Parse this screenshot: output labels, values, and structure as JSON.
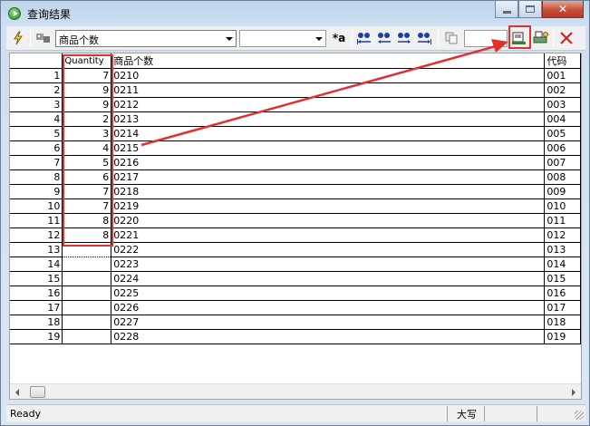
{
  "window": {
    "title": "查询结果"
  },
  "toolbar": {
    "field_combo_value": "商品个数",
    "filter_combo_value": "",
    "search_input_value": "",
    "regex_label": "*a"
  },
  "grid": {
    "columns": [
      "",
      "Quantity",
      "商品个数",
      "代码"
    ],
    "rows": [
      {
        "n": "1",
        "qty": "7",
        "code": "0210",
        "extra": "001"
      },
      {
        "n": "2",
        "qty": "9",
        "code": "0211",
        "extra": "002"
      },
      {
        "n": "3",
        "qty": "9",
        "code": "0212",
        "extra": "003"
      },
      {
        "n": "4",
        "qty": "2",
        "code": "0213",
        "extra": "004"
      },
      {
        "n": "5",
        "qty": "3",
        "code": "0214",
        "extra": "005"
      },
      {
        "n": "6",
        "qty": "4",
        "code": "0215",
        "extra": "006"
      },
      {
        "n": "7",
        "qty": "5",
        "code": "0216",
        "extra": "007"
      },
      {
        "n": "8",
        "qty": "6",
        "code": "0217",
        "extra": "008"
      },
      {
        "n": "9",
        "qty": "7",
        "code": "0218",
        "extra": "009"
      },
      {
        "n": "10",
        "qty": "7",
        "code": "0219",
        "extra": "010"
      },
      {
        "n": "11",
        "qty": "8",
        "code": "0220",
        "extra": "011"
      },
      {
        "n": "12",
        "qty": "8",
        "code": "0221",
        "extra": "012"
      },
      {
        "n": "13",
        "qty": "",
        "code": "0222",
        "extra": "013"
      },
      {
        "n": "14",
        "qty": "",
        "code": "0223",
        "extra": "014"
      },
      {
        "n": "15",
        "qty": "",
        "code": "0224",
        "extra": "015"
      },
      {
        "n": "16",
        "qty": "",
        "code": "0225",
        "extra": "016"
      },
      {
        "n": "17",
        "qty": "",
        "code": "0226",
        "extra": "017"
      },
      {
        "n": "18",
        "qty": "",
        "code": "0227",
        "extra": "018"
      },
      {
        "n": "19",
        "qty": "",
        "code": "0228",
        "extra": "019"
      }
    ]
  },
  "statusbar": {
    "status": "Ready",
    "caps": "大写"
  },
  "colors": {
    "highlight": "#e03030",
    "binoculars": "#1c3faa"
  }
}
